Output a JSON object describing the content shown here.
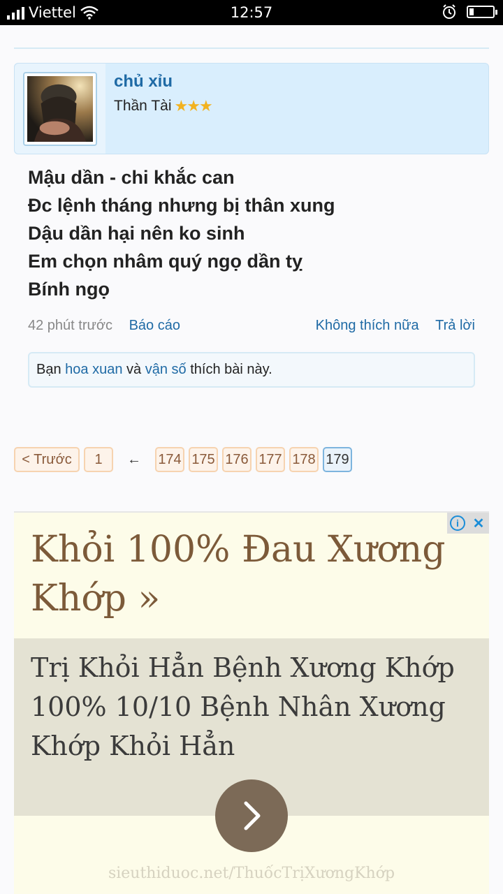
{
  "status_bar": {
    "carrier": "Viettel",
    "time": "12:57",
    "battery_level": 0.2
  },
  "post": {
    "username": "chủ xỉu",
    "user_title": "Thần Tài",
    "rating_stars": 3,
    "stars_text": "★★★",
    "message_lines": [
      "Mậu dần - chi khắc can",
      "Đc lệnh tháng nhưng bị thân xung",
      "Dậu dần hại nên ko sinh",
      "Em chọn nhâm quý ngọ dần tỵ",
      "Bính ngọ"
    ],
    "time_ago": "42 phút trước",
    "report_label": "Báo cáo",
    "unlike_label": "Không thích nữa",
    "reply_label": "Trả lời",
    "likes": {
      "prefix": "Bạn",
      "user1": "hoa xuan",
      "conj": "và",
      "user2": "vận số",
      "suffix": "thích bài này."
    }
  },
  "pagination": {
    "prev_label": "< Trước",
    "first": "1",
    "ellipsis": "←",
    "pages": [
      "174",
      "175",
      "176",
      "177",
      "178",
      "179"
    ],
    "current": "179"
  },
  "ad": {
    "title": "Khỏi 100% Đau Xương Khớp »",
    "description": "Trị Khỏi Hẳn Bệnh Xương Khớp 100% 10/10 Bệnh Nhân Xương Khớp Khỏi Hẳn",
    "url": "sieuthiduoc.net/ThuốcTrịXươngKhớp",
    "info_icon": "info-icon",
    "close_icon": "close-icon"
  }
}
